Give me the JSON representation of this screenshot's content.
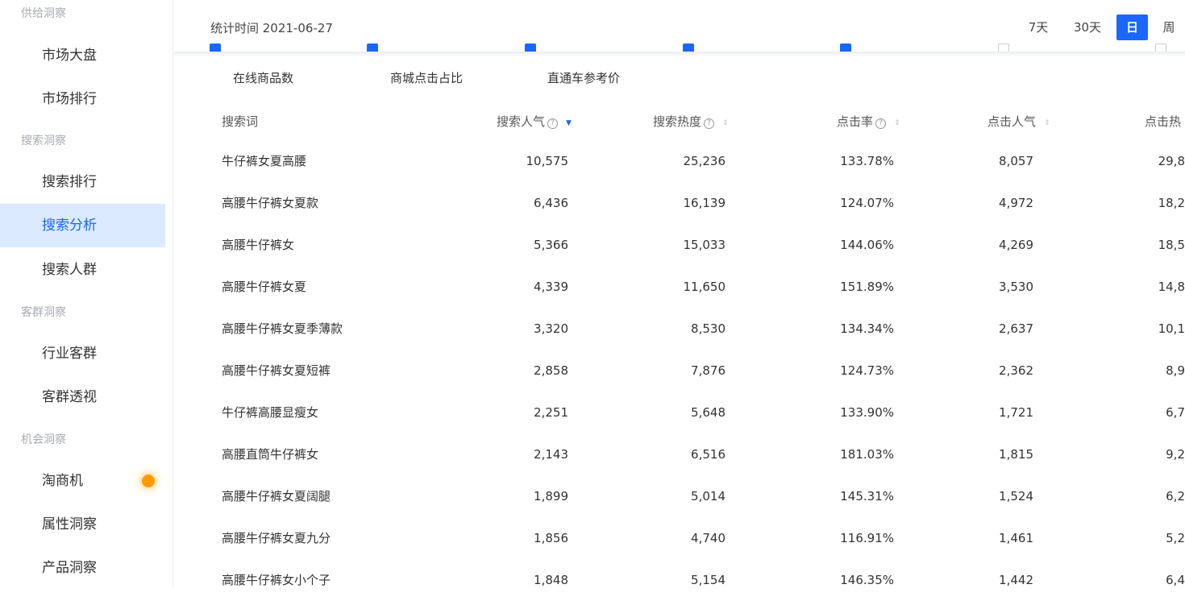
{
  "sidebar": {
    "groups": [
      "供给洞察",
      "搜索洞察",
      "客群洞察",
      "机会洞察"
    ],
    "items": [
      {
        "label": "市场大盘"
      },
      {
        "label": "市场排行"
      },
      {
        "label": "搜索排行"
      },
      {
        "label": "搜索分析"
      },
      {
        "label": "搜索人群"
      },
      {
        "label": "行业客群"
      },
      {
        "label": "客群透视"
      },
      {
        "label": "淘商机"
      },
      {
        "label": "属性洞察"
      },
      {
        "label": "产品洞察"
      }
    ],
    "active_item": "搜索分析"
  },
  "header": {
    "stat_time": "统计时间 2021-06-27",
    "periods": [
      "7天",
      "30天",
      "日",
      "周"
    ],
    "active_period": "日"
  },
  "indicator_options": [
    "在线商品数",
    "商城点击占比",
    "直通车参考价"
  ],
  "table": {
    "columns": [
      "搜索词",
      "搜索人气",
      "搜索热度",
      "点击率",
      "点击人气",
      "点击热"
    ],
    "rows": [
      [
        "牛仔裤女夏高腰",
        "10,575",
        "25,236",
        "133.78%",
        "8,057",
        "29,8"
      ],
      [
        "高腰牛仔裤女夏款",
        "6,436",
        "16,139",
        "124.07%",
        "4,972",
        "18,2"
      ],
      [
        "高腰牛仔裤女",
        "5,366",
        "15,033",
        "144.06%",
        "4,269",
        "18,5"
      ],
      [
        "高腰牛仔裤女夏",
        "4,339",
        "11,650",
        "151.89%",
        "3,530",
        "14,8"
      ],
      [
        "高腰牛仔裤女夏季薄款",
        "3,320",
        "8,530",
        "134.34%",
        "2,637",
        "10,1"
      ],
      [
        "高腰牛仔裤女夏短裤",
        "2,858",
        "7,876",
        "124.73%",
        "2,362",
        "8,9"
      ],
      [
        "牛仔裤高腰显瘦女",
        "2,251",
        "5,648",
        "133.90%",
        "1,721",
        "6,7"
      ],
      [
        "高腰直筒牛仔裤女",
        "2,143",
        "6,516",
        "181.03%",
        "1,815",
        "9,2"
      ],
      [
        "高腰牛仔裤女夏阔腿",
        "1,899",
        "5,014",
        "145.31%",
        "1,524",
        "6,2"
      ],
      [
        "高腰牛仔裤女夏九分",
        "1,856",
        "4,740",
        "116.91%",
        "1,461",
        "5,2"
      ],
      [
        "高腰牛仔裤女小个子",
        "1,848",
        "5,154",
        "146.35%",
        "1,442",
        "6,4"
      ]
    ]
  },
  "colors": {
    "accent": "#1a66ff",
    "active_bg": "#dbeaff",
    "notify_dot": "#ff9a00"
  },
  "icons": {
    "help": "question-circle-icon",
    "sort": "sort-caret-icon"
  }
}
